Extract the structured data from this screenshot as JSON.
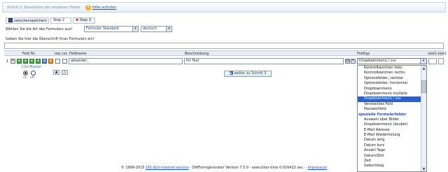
{
  "header": {
    "title": "Schritt 2: Bearbeiten der einzelnen Felder",
    "help_link": "Hilfe aufrufen"
  },
  "tabs": {
    "save": "zwischenspeichern",
    "step2": "Step 2",
    "step3": "Step 3"
  },
  "form_type": {
    "label": "Wählen Sie die Art des Formulars aus!",
    "form_value": "Formular Standard",
    "lang_value": "deutsch"
  },
  "heading": {
    "label": "Geben Sie hier die Überschrift ihres Formulars ein!",
    "value": ""
  },
  "grid": {
    "headers": {
      "feld_nr": "Feld Nr.",
      "req": "req",
      "csv": "csv",
      "feldname": "Feldname",
      "beschreibung": "Beschreibung",
      "feldtyp": "Feldtyp",
      "size1": "size1",
      "size2": "size2"
    },
    "row": {
      "number": "1",
      "feldname": "absender_",
      "beschreibung": "Ihr Text",
      "feldtyp": "Dropdownmenü / csv"
    }
  },
  "csv_master": {
    "label": "CSV-Master",
    "on": "on",
    "off": "off",
    "selected": "on"
  },
  "next_button": "weiter zu Schritt 3",
  "dropdown": {
    "items": [
      {
        "label": "Kontrollkästchen links",
        "kind": "item"
      },
      {
        "label": "Kontrollkästchen rechts",
        "kind": "item"
      },
      {
        "label": "Optionsfelder, vertikal",
        "kind": "item"
      },
      {
        "label": "Optionsfelder, horizontal",
        "kind": "item"
      },
      {
        "label": "Dropdownmenü",
        "kind": "item"
      },
      {
        "label": "Dropdownmenü multiple",
        "kind": "item"
      },
      {
        "label": "Dropdownmenü / csv",
        "kind": "selected"
      },
      {
        "label": "Verstecktes Feld",
        "kind": "item"
      },
      {
        "label": "Passwortfeld",
        "kind": "item"
      },
      {
        "label": "spezielle Formularfelder",
        "kind": "group"
      },
      {
        "label": "Auswahl über Bilder",
        "kind": "item"
      },
      {
        "label": "Dropdownmenü (double)",
        "kind": "item"
      },
      {
        "label": "E-Mail Adresse",
        "kind": "item"
      },
      {
        "label": "E-Mail Wiederholung",
        "kind": "item"
      },
      {
        "label": "Datum lang",
        "kind": "item"
      },
      {
        "label": "Datum kurz",
        "kind": "item"
      },
      {
        "label": "Anzahl Tage",
        "kind": "item"
      },
      {
        "label": "Datum/Zeit",
        "kind": "item"
      },
      {
        "label": "Zeit",
        "kind": "item"
      },
      {
        "label": "Geburtstag",
        "kind": "item"
      }
    ]
  },
  "footer": {
    "prefix": "© 1999-2015",
    "company_link": "DIS dürr-internet-service",
    "middle": "- DWFormgenerator Version 7.5.0 - execution-time 0.016422 sec. -",
    "impressum": "Impressum"
  }
}
